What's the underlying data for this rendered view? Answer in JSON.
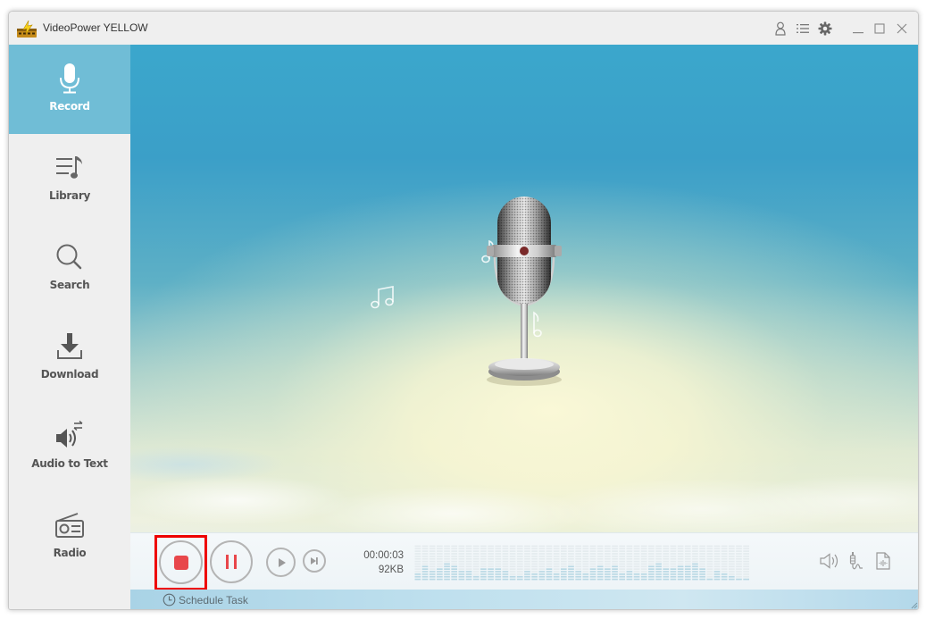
{
  "window": {
    "title": "VideoPower YELLOW",
    "logo_icon": "app-logo-icon",
    "title_controls": [
      {
        "name": "account-button",
        "icon": "user-icon"
      },
      {
        "name": "menu-list-button",
        "icon": "list-icon"
      },
      {
        "name": "settings-button",
        "icon": "gear-icon"
      },
      {
        "name": "minimize-button",
        "icon": "minimize-icon"
      },
      {
        "name": "maximize-button",
        "icon": "maximize-icon"
      },
      {
        "name": "close-button",
        "icon": "close-icon"
      }
    ]
  },
  "sidebar": {
    "items": [
      {
        "label": "Record",
        "icon": "microphone-icon",
        "active": true
      },
      {
        "label": "Library",
        "icon": "music-list-icon",
        "active": false
      },
      {
        "label": "Search",
        "icon": "search-icon",
        "active": false
      },
      {
        "label": "Download",
        "icon": "download-icon",
        "active": false
      },
      {
        "label": "Audio to Text",
        "icon": "audio-to-text-icon",
        "active": false
      },
      {
        "label": "Radio",
        "icon": "radio-icon",
        "active": false
      }
    ]
  },
  "recorder": {
    "elapsed": "00:00:03",
    "size": "92KB",
    "buttons": {
      "stop": {
        "icon": "stop-icon",
        "highlighted": true
      },
      "pause": {
        "icon": "pause-icon"
      },
      "play": {
        "icon": "play-icon"
      },
      "next": {
        "icon": "skip-next-icon"
      }
    },
    "spectrum_levels": [
      3,
      6,
      4,
      5,
      7,
      6,
      4,
      4,
      2,
      5,
      5,
      5,
      4,
      2,
      2,
      4,
      3,
      4,
      5,
      3,
      5,
      6,
      4,
      3,
      5,
      6,
      5,
      6,
      3,
      4,
      3,
      3,
      6,
      7,
      5,
      5,
      6,
      6,
      7,
      5,
      1,
      4,
      3,
      2,
      1,
      1
    ],
    "spectrum_max": 14,
    "right_icons": [
      {
        "name": "speaker-output-button",
        "icon": "speaker-icon"
      },
      {
        "name": "audio-input-button",
        "icon": "audio-jack-icon"
      },
      {
        "name": "audio-file-button",
        "icon": "audio-file-icon"
      }
    ],
    "schedule_label": "Schedule Task"
  },
  "colors": {
    "accent": "#70bdd6",
    "stop_red": "#e8474b",
    "highlight_red": "#ee0000",
    "spectrum_on": "#b9d8e4",
    "spectrum_off": "#e4ebee"
  }
}
